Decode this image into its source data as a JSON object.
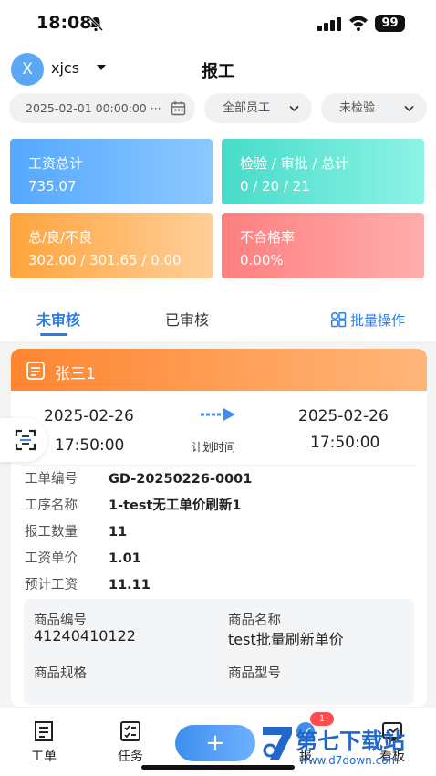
{
  "status_bar": {
    "time": "18:08",
    "battery": "99"
  },
  "header": {
    "avatar_initial": "X",
    "user": "xjcs",
    "title": "报工"
  },
  "filters": {
    "date": "2025-02-01 00:00:00 ···",
    "staff": "全部员工",
    "inspection": "未检验"
  },
  "stats": {
    "wage_label": "工资总计",
    "wage_value": "735.07",
    "inspect_label": "检验 / 审批 / 总计",
    "inspect_value": "0 / 20 / 21",
    "total_label": "总/良/不良",
    "total_value": "302.00 / 301.65 / 0.00",
    "rate_label": "不合格率",
    "rate_value": "0.00%"
  },
  "tabs": {
    "pending": "未审核",
    "reviewed": "已审核",
    "batch": "批量操作"
  },
  "card": {
    "name": "张三1",
    "start_date": "2025-02-26",
    "start_time": "17:50:00",
    "end_date": "2025-02-26",
    "end_time": "17:50:00",
    "plan_label": "计划时间",
    "fields": [
      {
        "label": "工单编号",
        "value": "GD-20250226-0001"
      },
      {
        "label": "工序名称",
        "value": "1-test无工单价刷新1"
      },
      {
        "label": "报工数量",
        "value": "11"
      },
      {
        "label": "工资单价",
        "value": "1.01"
      },
      {
        "label": "预计工资",
        "value": "11.11"
      }
    ],
    "goods": {
      "code_label": "商品编号",
      "code_value": "41240410122",
      "name_label": "商品名称",
      "name_value": "test批量刷新单价",
      "spec_label": "商品规格",
      "model_label": "商品型号"
    }
  },
  "nav": {
    "work": "工单",
    "task": "任务",
    "plus": "+",
    "report": "报",
    "report_badge": "1",
    "board": "看板"
  },
  "watermark": {
    "title": "第七下载站",
    "url": "www.d7down.com"
  }
}
